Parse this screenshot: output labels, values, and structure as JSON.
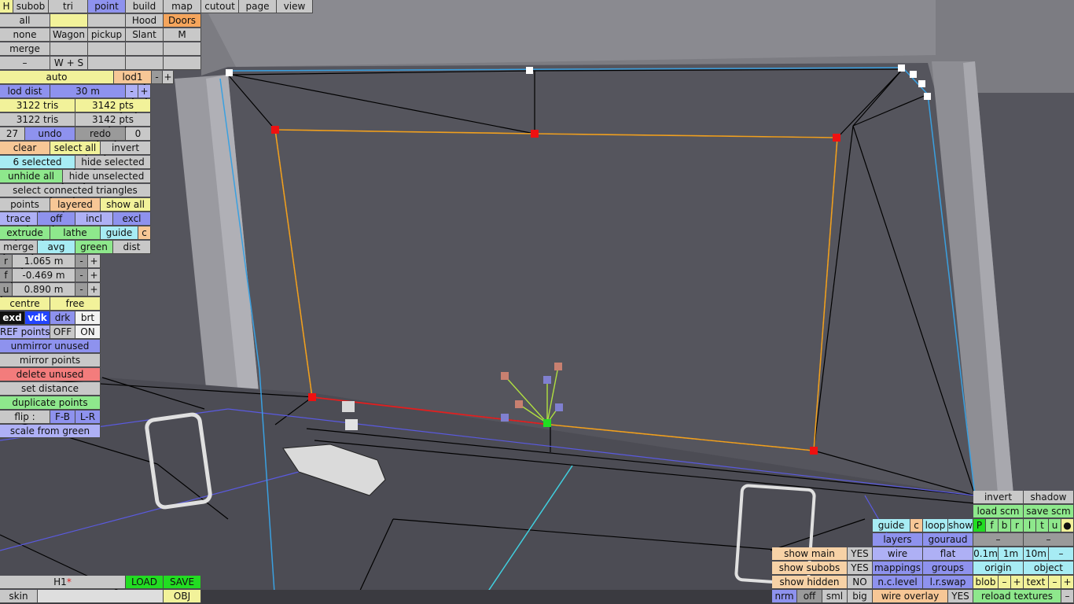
{
  "top_menu": {
    "h": "H",
    "subob": "subob",
    "tri": "tri",
    "point": "point",
    "build": "build",
    "map": "map",
    "cutout": "cutout",
    "page": "page",
    "view": "view"
  },
  "row2": {
    "all": "all",
    "hood": "Hood",
    "doors": "Doors"
  },
  "row3": {
    "none": "none",
    "wagon": "Wagon",
    "pickup": "pickup",
    "slant": "Slant",
    "m": "M"
  },
  "row4": {
    "merge": "merge"
  },
  "row5": {
    "minus": "–",
    "ws": "W + S"
  },
  "lod": {
    "auto": "auto",
    "lod1": "lod1",
    "minus": "-",
    "plus": "+",
    "dist_label": "lod dist",
    "dist_value": "30 m"
  },
  "stats": {
    "tris1": "3122 tris",
    "pts1": "3142 pts",
    "tris2": "3122 tris",
    "pts2": "3142 pts"
  },
  "history": {
    "count": "27",
    "undo": "undo",
    "redo": "redo",
    "redo_count": "0"
  },
  "selection": {
    "clear": "clear",
    "select_all": "select all",
    "invert": "invert",
    "selected": "6 selected",
    "hide_selected": "hide selected",
    "unhide_all": "unhide all",
    "hide_unselected": "hide unselected",
    "select_connected": "select connected triangles"
  },
  "display": {
    "points": "points",
    "layered": "layered",
    "show_all": "show all"
  },
  "trace": {
    "trace": "trace",
    "off": "off",
    "incl": "incl",
    "excl": "excl"
  },
  "tools": {
    "extrude": "extrude",
    "lathe": "lathe",
    "guide": "guide",
    "c": "c",
    "merge": "merge",
    "avg": "avg",
    "green": "green",
    "dist": "dist"
  },
  "coords": [
    {
      "axis": "r",
      "value": "1.065 m"
    },
    {
      "axis": "f",
      "value": "-0.469 m"
    },
    {
      "axis": "u",
      "value": "0.890 m"
    }
  ],
  "pivot": {
    "centre": "centre",
    "free": "free"
  },
  "shade": {
    "exd": "exd",
    "vdk": "vdk",
    "drk": "drk",
    "brt": "brt"
  },
  "ref": {
    "label": "REF points",
    "off": "OFF",
    "on": "ON"
  },
  "ops": {
    "unmirror": "unmirror unused",
    "mirror": "mirror points",
    "delete": "delete unused",
    "set_distance": "set distance",
    "duplicate": "duplicate points",
    "flip_label": "flip :",
    "flip_fb": "F-B",
    "flip_lr": "L-R",
    "scale": "scale from green"
  },
  "file": {
    "name": "H1",
    "modified": "*",
    "load": "LOAD",
    "save": "SAVE",
    "skin": "skin",
    "obj": "OBJ"
  },
  "right_panel": {
    "invert": "invert",
    "shadow": "shadow",
    "load_scm": "load scm",
    "save_scm": "save scm",
    "guide": "guide",
    "c": "c",
    "loop": "loop",
    "show": "show",
    "letters": [
      "P",
      "f",
      "b",
      "r",
      "l",
      "t",
      "u",
      "●"
    ],
    "layers": "layers",
    "gouraud": "gouraud",
    "dash": "–",
    "show_main": "show main",
    "show_main_val": "YES",
    "wire": "wire",
    "flat": "flat",
    "step1": "0.1m",
    "step2": "1m",
    "step3": "10m",
    "step_minus": "–",
    "show_subobs": "show subobs",
    "show_subobs_val": "YES",
    "mappings": "mappings",
    "groups": "groups",
    "origin": "origin",
    "object": "object",
    "show_hidden": "show hidden",
    "show_hidden_val": "NO",
    "nc_level": "n.c.level",
    "lr_swap": "l.r.swap",
    "blob": "blob",
    "text": "text",
    "minus": "–",
    "plus": "+",
    "nrm": "nrm",
    "off": "off",
    "sml": "sml",
    "big": "big",
    "wire_overlay": "wire overlay",
    "wire_overlay_val": "YES",
    "reload_textures": "reload textures"
  }
}
